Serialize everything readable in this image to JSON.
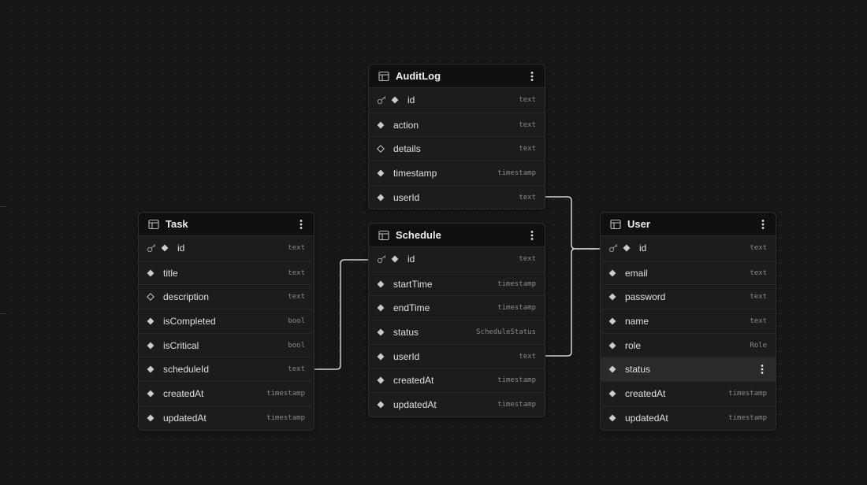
{
  "colors": {
    "background": "#161616",
    "table_body": "#1c1c1d",
    "table_header": "#101011",
    "connector": "#cfcfcf",
    "text": "#e0e0e0",
    "type_text": "#8a8a8a"
  },
  "icons": {
    "table": "table-grid-icon",
    "menu": "vertical-dots-icon",
    "primary_key": "key-icon",
    "not_null": "filled-diamond-icon",
    "nullable": "outline-diamond-icon"
  },
  "tables": {
    "auditlog": {
      "name": "AuditLog",
      "columns": [
        {
          "name": "id",
          "type": "text",
          "pk": true,
          "nullable": false
        },
        {
          "name": "action",
          "type": "text",
          "pk": false,
          "nullable": false
        },
        {
          "name": "details",
          "type": "text",
          "pk": false,
          "nullable": true
        },
        {
          "name": "timestamp",
          "type": "timestamp",
          "pk": false,
          "nullable": false
        },
        {
          "name": "userId",
          "type": "text",
          "pk": false,
          "nullable": false
        }
      ]
    },
    "task": {
      "name": "Task",
      "columns": [
        {
          "name": "id",
          "type": "text",
          "pk": true,
          "nullable": false
        },
        {
          "name": "title",
          "type": "text",
          "pk": false,
          "nullable": false
        },
        {
          "name": "description",
          "type": "text",
          "pk": false,
          "nullable": true
        },
        {
          "name": "isCompleted",
          "type": "bool",
          "pk": false,
          "nullable": false
        },
        {
          "name": "isCritical",
          "type": "bool",
          "pk": false,
          "nullable": false
        },
        {
          "name": "scheduleId",
          "type": "text",
          "pk": false,
          "nullable": false
        },
        {
          "name": "createdAt",
          "type": "timestamp",
          "pk": false,
          "nullable": false
        },
        {
          "name": "updatedAt",
          "type": "timestamp",
          "pk": false,
          "nullable": false
        }
      ]
    },
    "schedule": {
      "name": "Schedule",
      "columns": [
        {
          "name": "id",
          "type": "text",
          "pk": true,
          "nullable": false
        },
        {
          "name": "startTime",
          "type": "timestamp",
          "pk": false,
          "nullable": false
        },
        {
          "name": "endTime",
          "type": "timestamp",
          "pk": false,
          "nullable": false
        },
        {
          "name": "status",
          "type": "ScheduleStatus",
          "pk": false,
          "nullable": false
        },
        {
          "name": "userId",
          "type": "text",
          "pk": false,
          "nullable": false
        },
        {
          "name": "createdAt",
          "type": "timestamp",
          "pk": false,
          "nullable": false
        },
        {
          "name": "updatedAt",
          "type": "timestamp",
          "pk": false,
          "nullable": false
        }
      ]
    },
    "user": {
      "name": "User",
      "columns": [
        {
          "name": "id",
          "type": "text",
          "pk": true,
          "nullable": false
        },
        {
          "name": "email",
          "type": "text",
          "pk": false,
          "nullable": false
        },
        {
          "name": "password",
          "type": "text",
          "pk": false,
          "nullable": false
        },
        {
          "name": "name",
          "type": "text",
          "pk": false,
          "nullable": false
        },
        {
          "name": "role",
          "type": "Role",
          "pk": false,
          "nullable": false
        },
        {
          "name": "status",
          "type": "",
          "pk": false,
          "nullable": false,
          "hovered": true
        },
        {
          "name": "createdAt",
          "type": "timestamp",
          "pk": false,
          "nullable": false
        },
        {
          "name": "updatedAt",
          "type": "timestamp",
          "pk": false,
          "nullable": false
        }
      ]
    }
  },
  "relations": [
    {
      "from": "auditlog.userId",
      "to": "user.id"
    },
    {
      "from": "schedule.userId",
      "to": "user.id"
    },
    {
      "from": "task.scheduleId",
      "to": "schedule.id"
    }
  ]
}
